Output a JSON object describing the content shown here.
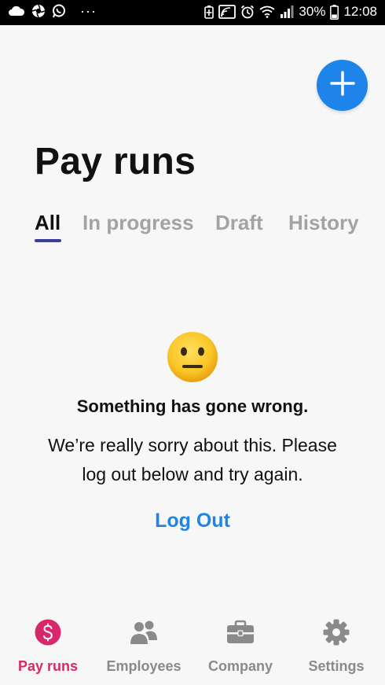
{
  "status_bar": {
    "battery": "30%",
    "time": "12:08",
    "left_icons": [
      "cloud-icon",
      "aperture-icon",
      "whatsapp-icon",
      "more-dots-icon"
    ],
    "right_icons": [
      "battery-saver-icon",
      "cast-icon",
      "alarm-icon",
      "wifi-icon",
      "signal-icon",
      "battery-icon"
    ]
  },
  "header": {
    "title": "Pay runs",
    "add_icon": "plus-icon"
  },
  "tabs": [
    {
      "label": "All",
      "active": true
    },
    {
      "label": "In progress",
      "active": false
    },
    {
      "label": "Draft",
      "active": false
    },
    {
      "label": "History",
      "active": false
    }
  ],
  "error": {
    "emoji": "neutral-face-icon",
    "title": "Something has gone wrong.",
    "message_line1": "We’re really sorry about this. Please",
    "message_line2": "log out below and try again.",
    "action": "Log Out"
  },
  "bottom_nav": [
    {
      "label": "Pay runs",
      "icon": "dollar-icon",
      "active": true
    },
    {
      "label": "Employees",
      "icon": "people-icon",
      "active": false
    },
    {
      "label": "Company",
      "icon": "briefcase-icon",
      "active": false
    },
    {
      "label": "Settings",
      "icon": "gear-icon",
      "active": false
    }
  ],
  "colors": {
    "accent_blue": "#1f84e9",
    "active_pink": "#d6286b",
    "tab_underline": "#3b3f99",
    "inactive_gray": "#a3a3a3",
    "background": "#f7f7f7"
  }
}
